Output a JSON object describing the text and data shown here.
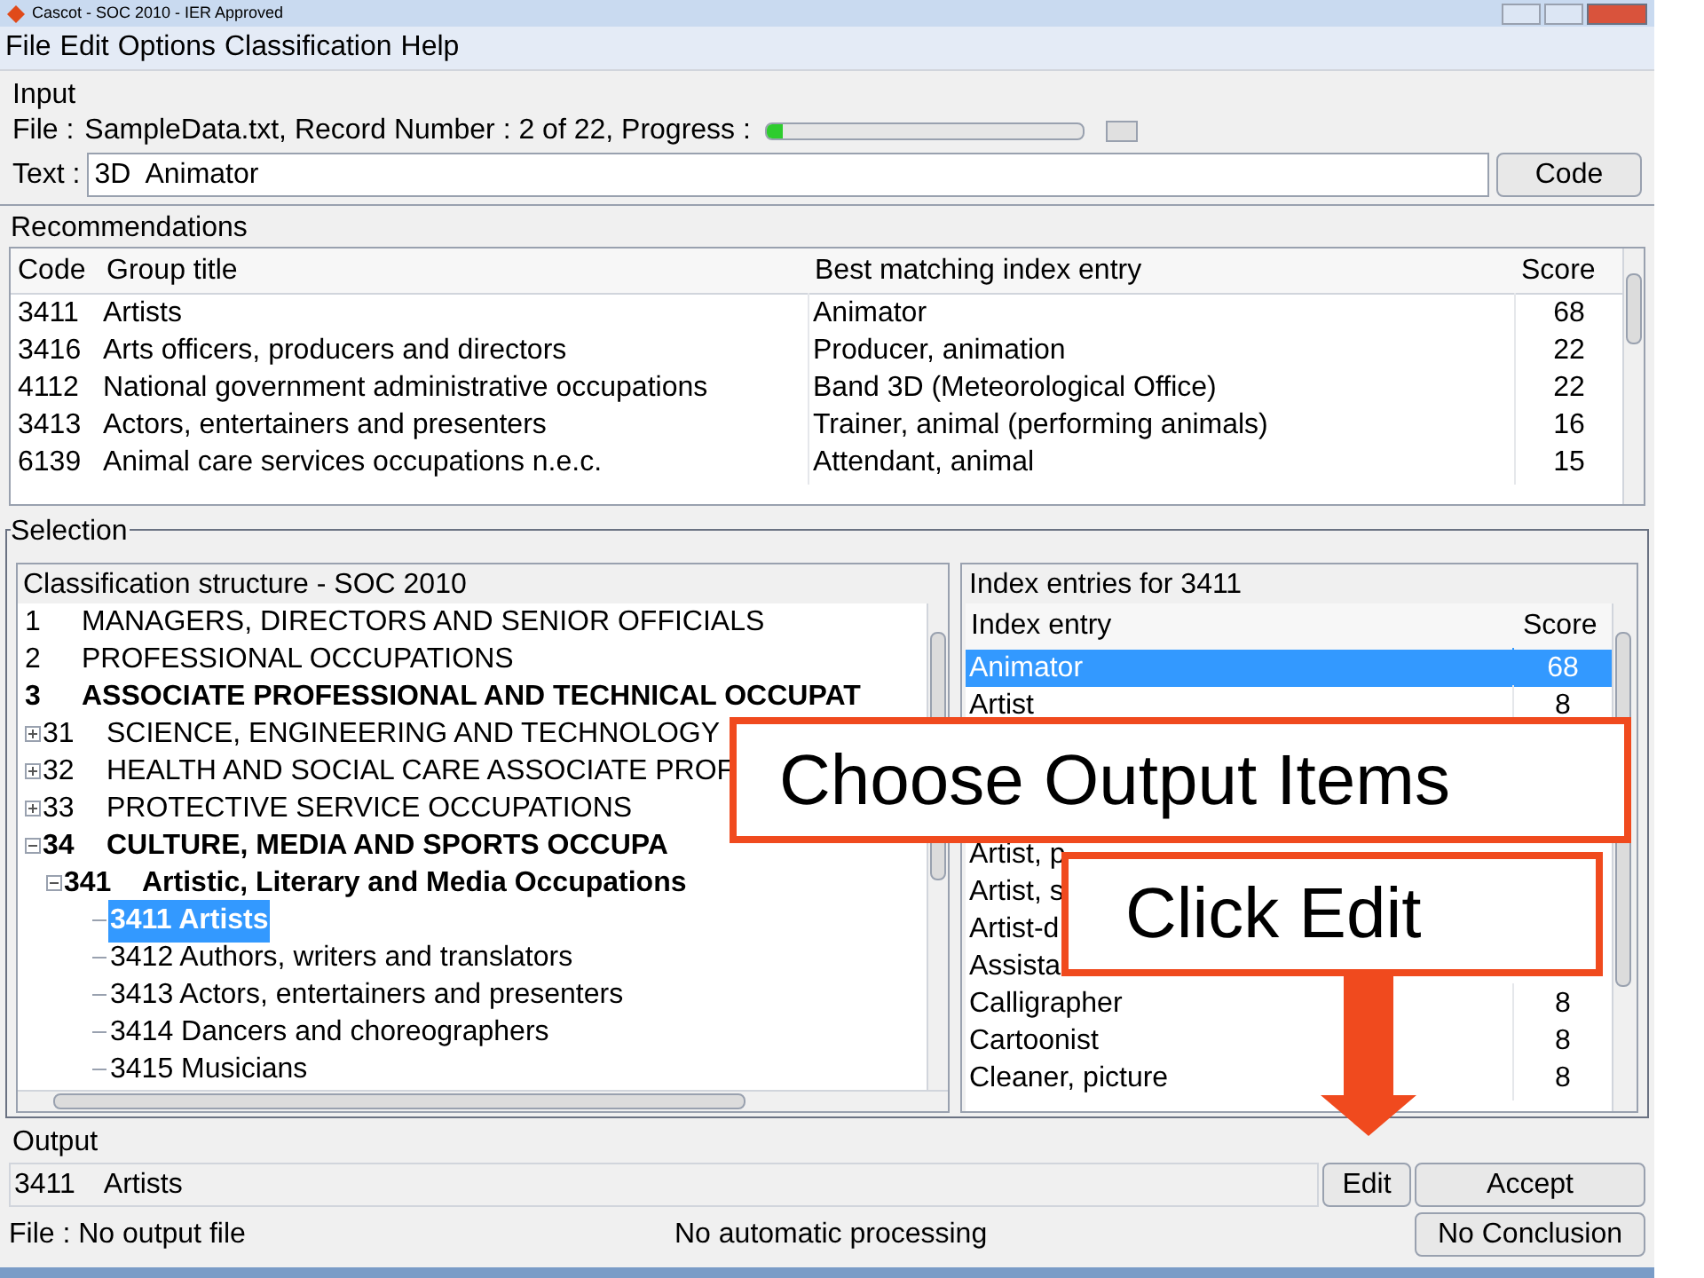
{
  "window": {
    "title": "Cascot - SOC 2010  - IER Approved"
  },
  "menu": [
    "File",
    "Edit",
    "Options",
    "Classification",
    "Help"
  ],
  "input": {
    "title": "Input",
    "file_label": "File :",
    "file_info": "SampleData.txt, Record Number : 2 of 22, Progress :",
    "progress": {
      "level": 0.05
    },
    "text_label": "Text :",
    "text_value": "3D  Animator",
    "code_button": "Code"
  },
  "recommendations": {
    "title": "Recommendations",
    "columns": [
      "Code",
      "Group title",
      "Best matching index entry",
      "Score"
    ],
    "rows": [
      {
        "code": "3411",
        "group": "Artists",
        "entry": "Animator",
        "score": "68"
      },
      {
        "code": "3416",
        "group": "Arts officers, producers and directors",
        "entry": "Producer, animation",
        "score": "22"
      },
      {
        "code": "4112",
        "group": "National government administrative occupations",
        "entry": "Band 3D (Meteorological Office)",
        "score": "22"
      },
      {
        "code": "3413",
        "group": "Actors, entertainers and presenters",
        "entry": "Trainer, animal (performing animals)",
        "score": "16"
      },
      {
        "code": "6139",
        "group": "Animal care services occupations n.e.c.",
        "entry": "Attendant, animal",
        "score": "15"
      }
    ]
  },
  "selection": {
    "title": "Selection",
    "structure": {
      "title": "Classification structure - SOC 2010",
      "tree": [
        {
          "code": "1",
          "label": "MANAGERS, DIRECTORS AND SENIOR OFFICIALS"
        },
        {
          "code": "2",
          "label": "PROFESSIONAL OCCUPATIONS"
        },
        {
          "code": "3",
          "label": "ASSOCIATE PROFESSIONAL AND TECHNICAL OCCUPAT",
          "expanded": true,
          "children": [
            {
              "code": "31",
              "label": "SCIENCE, ENGINEERING AND TECHNOLOGY",
              "expanded": false
            },
            {
              "code": "32",
              "label": "HEALTH AND SOCIAL CARE ASSOCIATE PROF",
              "expanded": false
            },
            {
              "code": "33",
              "label": "PROTECTIVE SERVICE OCCUPATIONS",
              "expanded": false
            },
            {
              "code": "34",
              "label": "CULTURE, MEDIA AND SPORTS OCCUPA",
              "expanded": true,
              "children": [
                {
                  "code": "341",
                  "label": "Artistic, Literary and Media Occupations",
                  "expanded": true,
                  "children": [
                    {
                      "code": "3411",
                      "label": "Artists",
                      "selected": true
                    },
                    {
                      "code": "3412",
                      "label": "Authors, writers and translators",
                      "selected": false
                    },
                    {
                      "code": "3413",
                      "label": "Actors, entertainers and presenters",
                      "selected": false
                    },
                    {
                      "code": "3414",
                      "label": "Dancers and choreographers",
                      "selected": false
                    },
                    {
                      "code": "3415",
                      "label": "Musicians",
                      "selected": false
                    }
                  ]
                }
              ]
            }
          ]
        }
      ]
    },
    "index": {
      "title": "Index entries for 3411",
      "columns": [
        "Index entry",
        "Score"
      ],
      "rows": [
        {
          "entry": "Animator",
          "score": "68",
          "selected": true
        },
        {
          "entry": "Artist",
          "score": "8",
          "selected": false
        },
        {
          "entry": "Artist, p",
          "selected": false
        },
        {
          "entry": "Artist, s",
          "selected": false
        },
        {
          "entry": "Artist-d",
          "selected": false
        },
        {
          "entry": "Assista",
          "selected": false
        },
        {
          "entry": "Calligrapher",
          "score": "8",
          "selected": false
        },
        {
          "entry": "Cartoonist",
          "score": "8",
          "selected": false
        },
        {
          "entry": "Cleaner, picture",
          "score": "8",
          "selected": false
        }
      ]
    }
  },
  "output": {
    "title": "Output",
    "code": "3411",
    "label": "Artists",
    "edit_button": "Edit",
    "accept_button": "Accept"
  },
  "status": {
    "file": "File : No output file",
    "processing": "No automatic processing",
    "conclusion_button": "No Conclusion"
  },
  "callouts": [
    "Choose Output Items",
    "Click Edit"
  ]
}
